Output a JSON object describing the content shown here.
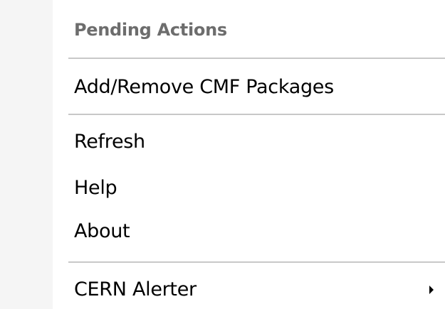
{
  "menu": {
    "header": "Pending Actions",
    "add_remove": "Add/Remove CMF Packages",
    "refresh": "Refresh",
    "help": "Help",
    "about": "About",
    "cern_alerter": "CERN Alerter"
  },
  "icons": {
    "submenu": "submenu-arrow-icon"
  }
}
